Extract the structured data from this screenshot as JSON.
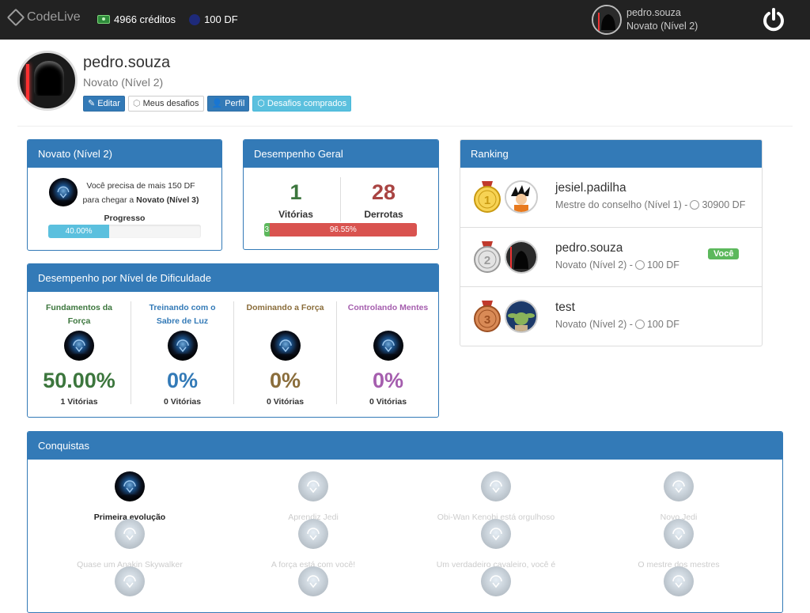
{
  "topbar": {
    "brand": "CodeLive",
    "credits": "4966 créditos",
    "df": "100 DF",
    "username": "pedro.souza",
    "level": "Novato (Nível 2)"
  },
  "profile": {
    "name": "pedro.souza",
    "level": "Novato (Nível 2)",
    "buttons": {
      "edit": "Editar",
      "my_challenges": "Meus desafios",
      "profile": "Perfil",
      "bought": "Desafios comprados"
    }
  },
  "level_panel": {
    "title": "Novato (Nível 2)",
    "text_line1": "Você precisa de mais 150 DF",
    "text_line2_prefix": "para chegar a ",
    "text_line2_bold": "Novato (Nível 3)",
    "progress_label": "Progresso",
    "progress_text": "40.00%",
    "progress_value": 40
  },
  "overall": {
    "title": "Desempenho Geral",
    "wins": "1",
    "wins_label": "Vitórias",
    "losses": "28",
    "losses_label": "Derrotas",
    "win_text": "3",
    "loss_text": "96.55%",
    "win_ratio": 3.45,
    "colors": {
      "wins": "#3c763d",
      "losses": "#a94442"
    }
  },
  "difficulty": {
    "title": "Desempenho por Nível de Dificuldade",
    "levels": [
      {
        "title": "Fundamentos da Força",
        "pct": "50.00%",
        "wins": "1 Vitórias",
        "color": "#3c763d"
      },
      {
        "title": "Treinando com o Sabre de Luz",
        "pct": "0%",
        "wins": "0 Vitórias",
        "color": "#337ab7"
      },
      {
        "title": "Dominando a Força",
        "pct": "0%",
        "wins": "0 Vitórias",
        "color": "#8a6d3b"
      },
      {
        "title": "Controlando Mentes",
        "pct": "0%",
        "wins": "0 Vitórias",
        "color": "#a55eae"
      }
    ]
  },
  "ranking": {
    "title": "Ranking",
    "entries": [
      {
        "medal": "1",
        "name": "jesiel.padilha",
        "level": "Mestre do conselho (Nível 1) -",
        "df": "30900 DF",
        "you": false
      },
      {
        "medal": "2",
        "name": "pedro.souza",
        "level": "Novato (Nível 2) -",
        "df": "100 DF",
        "you": true
      },
      {
        "medal": "3",
        "name": "test",
        "level": "Novato (Nível 2) -",
        "df": "100 DF",
        "you": false
      }
    ],
    "you_label": "Você"
  },
  "achievements": {
    "title": "Conquistas",
    "items": [
      {
        "label": "Primeira evolução",
        "unlocked": true
      },
      {
        "label": "Aprendiz Jedi",
        "unlocked": false
      },
      {
        "label": "Obi-Wan Kenobi está orgulhoso",
        "unlocked": false
      },
      {
        "label": "Novo Jedi",
        "unlocked": false
      },
      {
        "label": "Quase um Anakin Skywalker",
        "unlocked": false
      },
      {
        "label": "A força está com você!",
        "unlocked": false
      },
      {
        "label": "Um verdadeiro cavaleiro, você é",
        "unlocked": false
      },
      {
        "label": "O mestre dos mestres",
        "unlocked": false
      },
      {
        "label": "",
        "unlocked": false
      },
      {
        "label": "",
        "unlocked": false
      },
      {
        "label": "",
        "unlocked": false
      },
      {
        "label": "",
        "unlocked": false
      }
    ]
  }
}
